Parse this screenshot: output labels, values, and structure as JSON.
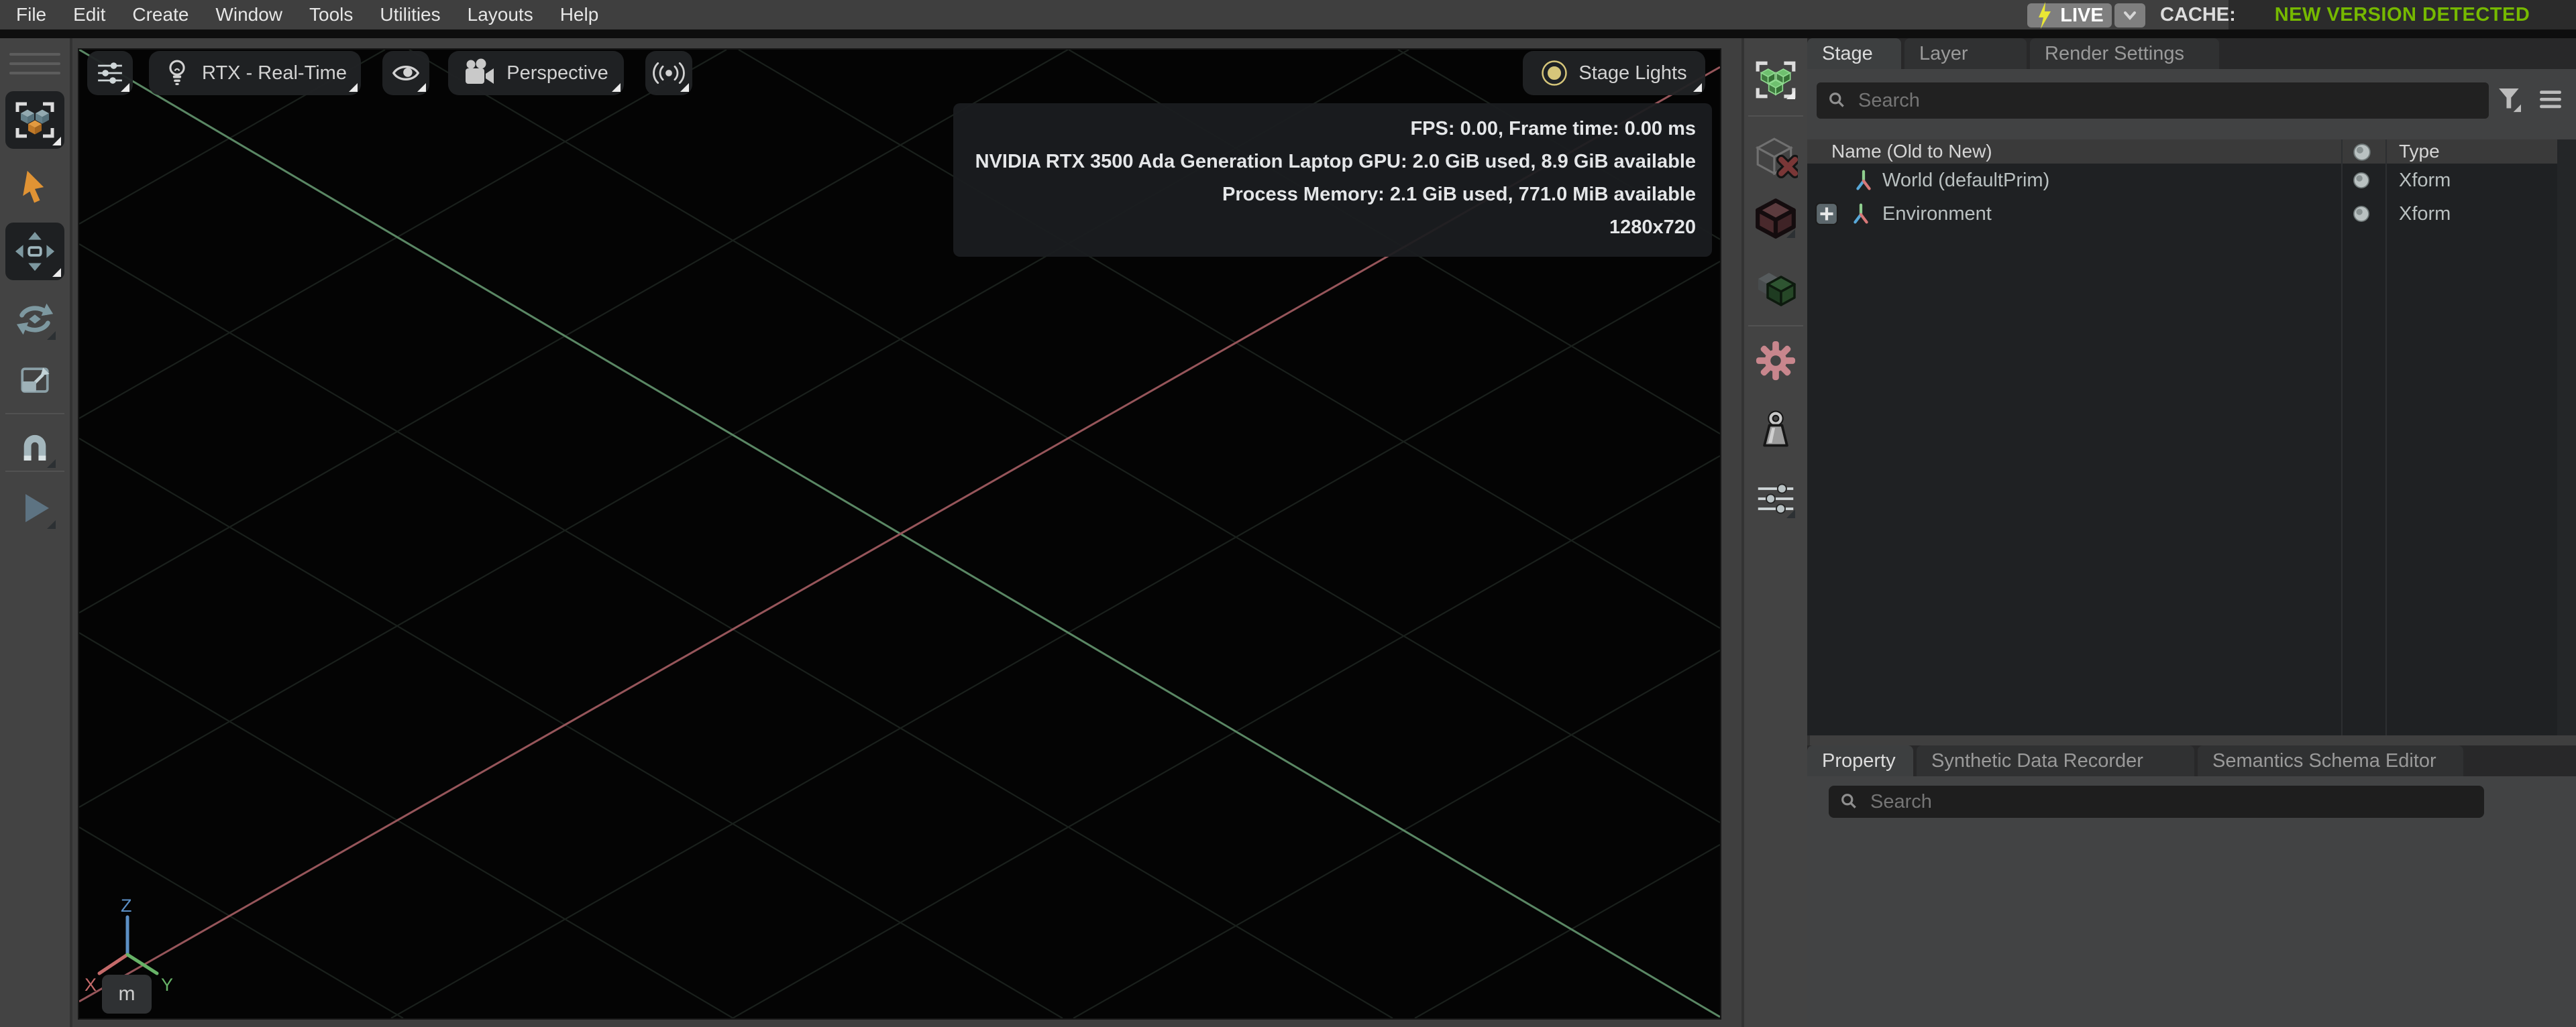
{
  "menu": {
    "items": [
      "File",
      "Edit",
      "Create",
      "Window",
      "Tools",
      "Utilities",
      "Layouts",
      "Help"
    ]
  },
  "topbar": {
    "live": "LIVE",
    "cache": "CACHE:",
    "status": "NEW VERSION DETECTED",
    "status_color": "#76b900",
    "bolt_color": "#e9e635"
  },
  "viewport": {
    "renderer": "RTX - Real-Time",
    "camera": "Perspective",
    "stage_lights": "Stage Lights",
    "stats": {
      "fps": "FPS: 0.00, Frame time: 0.00 ms",
      "gpu": "NVIDIA RTX 3500 Ada Generation Laptop GPU: 2.0 GiB used, 8.9 GiB available",
      "memory": "Process Memory: 2.1 GiB used, 771.0 MiB available",
      "resolution": "1280x720"
    },
    "axis": {
      "x": "X",
      "y": "Y",
      "z": "Z",
      "unit": "m"
    },
    "colors": {
      "background": "#040404",
      "grid": "#1a201c",
      "x_axis": "#96555a",
      "y_axis": "#5a8764"
    }
  },
  "stage_panel": {
    "tabs": [
      "Stage",
      "Layer",
      "Render Settings"
    ],
    "active_tab": "Stage",
    "search_placeholder": "Search",
    "columns": {
      "name": "Name (Old to New)",
      "type": "Type"
    },
    "rows": [
      {
        "name": "World (defaultPrim)",
        "type": "Xform"
      },
      {
        "name": "Environment",
        "type": "Xform"
      }
    ]
  },
  "property_panel": {
    "tabs": [
      "Property",
      "Synthetic Data Recorder",
      "Semantics Schema Editor"
    ],
    "active_tab": "Property",
    "search_placeholder": "Search"
  }
}
